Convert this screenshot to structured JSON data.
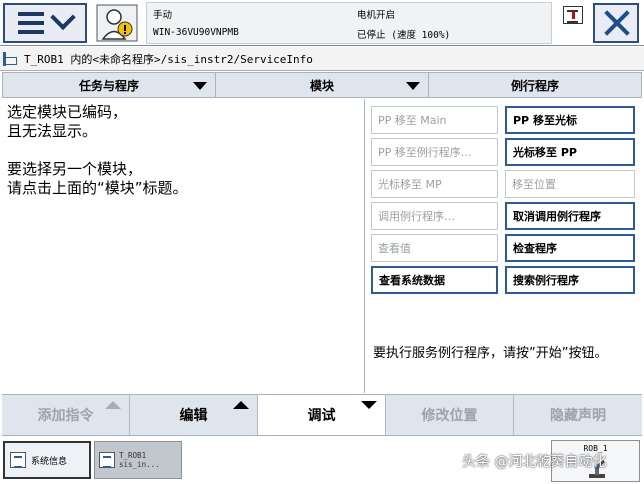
{
  "header": {
    "mode": "手动",
    "system_name": "WIN-36VU90VNPMB",
    "motor_state": "电机开启",
    "program_state": "已停止 (速度 100%)"
  },
  "breadcrumb": {
    "path": "T_ROB1 内的<未命名程序>/sis_instr2/ServiceInfo"
  },
  "columns": [
    "任务与程序",
    "模块",
    "例行程序"
  ],
  "message": "选定模块已编码，\n且无法显示。\n\n要选择另一个模块，\n请点击上面的“模块”标题。",
  "service": {
    "buttons": [
      {
        "label": "PP 移至 Main",
        "enabled": false
      },
      {
        "label": "PP 移至光标",
        "enabled": true
      },
      {
        "label": "PP 移至例行程序...",
        "enabled": false
      },
      {
        "label": "光标移至 PP",
        "enabled": true
      },
      {
        "label": "光标移至 MP",
        "enabled": false
      },
      {
        "label": "移至位置",
        "enabled": false
      },
      {
        "label": "调用例行程序…",
        "enabled": false
      },
      {
        "label": "取消调用例行程序",
        "enabled": true
      },
      {
        "label": "查看值",
        "enabled": false
      },
      {
        "label": "检查程序",
        "enabled": true
      },
      {
        "label": "查看系统数据",
        "enabled": true
      },
      {
        "label": "搜索例行程序",
        "enabled": true
      }
    ],
    "note": "要执行服务例行程序，请按”开始”按钮。"
  },
  "bottom_bar": {
    "add_instruction": "添加指令",
    "edit": "编辑",
    "debug": "调试",
    "modify_position": "修改位置",
    "hide_declarations": "隐藏声明"
  },
  "taskbar": {
    "sysinfo": "系统信息",
    "program_line1": "T_ROB1",
    "program_line2": "sis_in...",
    "robot_unit": "ROB_1"
  },
  "watermark": "头条 @河北乾葵自动化",
  "icons": {
    "menu": "hamburger-menu-icon",
    "operator": "operator-window-icon",
    "quickset": "quickset-icon",
    "close": "close-icon",
    "breadcrumb": "program-editor-icon",
    "robot": "robot-unit-icon"
  },
  "colors": {
    "accent": "#2d5c93",
    "header_bg": "#dfe5ec",
    "disabled_text": "#9aa0a6"
  }
}
